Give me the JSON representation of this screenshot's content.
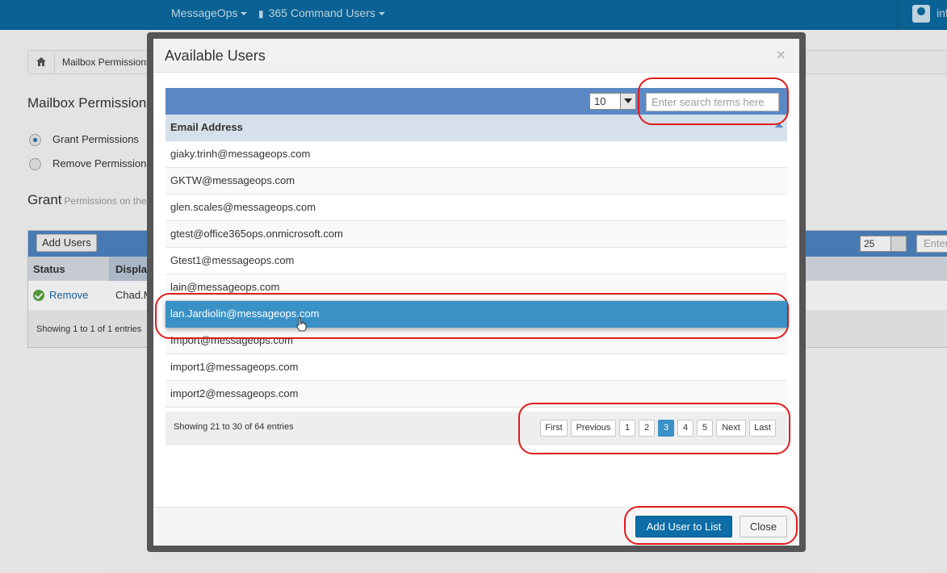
{
  "topnav": {
    "brand": "MessageOps",
    "menu": "365 Command Users",
    "user": "inf"
  },
  "background": {
    "breadcrumb": "Mailbox Permissions",
    "page_title": "Mailbox Permissions",
    "radio_grant": "Grant Permissions",
    "radio_remove": "Remove Permissions",
    "grant_title": "Grant",
    "grant_subtitle": "Permissions on the",
    "add_users": "Add Users",
    "page_size": "25",
    "search_placeholder": "Enter",
    "col_status": "Status",
    "col_display": "Display",
    "row_action": "Remove",
    "row_name": "Chad.Mo",
    "footer": "Showing 1 to 1 of 1 entries"
  },
  "modal": {
    "title": "Available Users",
    "close_glyph": "×",
    "page_size": "10",
    "search_placeholder": "Enter search terms here",
    "column": "Email Address",
    "rows": [
      "giaky.trinh@messageops.com",
      "GKTW@messageops.com",
      "glen.scales@messageops.com",
      "gtest@office365ops.onmicrosoft.com",
      "Gtest1@messageops.com",
      "lain@messageops.com",
      "lan.Jardiolin@messageops.com",
      "Import@messageops.com",
      "import1@messageops.com",
      "import2@messageops.com"
    ],
    "selected_row": 6,
    "info": "Showing 21 to 30 of 64 entries",
    "pager": {
      "first": "First",
      "previous": "Previous",
      "pages": [
        "1",
        "2",
        "3",
        "4",
        "5"
      ],
      "current_page": "3",
      "next": "Next",
      "last": "Last"
    },
    "add_button": "Add User to List",
    "close_button": "Close"
  },
  "colors": {
    "nav": "#0a6aa1",
    "table_bar": "#5a89c5",
    "selected_row": "#3a91c6",
    "primary_button": "#0d6da6",
    "annotation": "#e11b1b"
  }
}
